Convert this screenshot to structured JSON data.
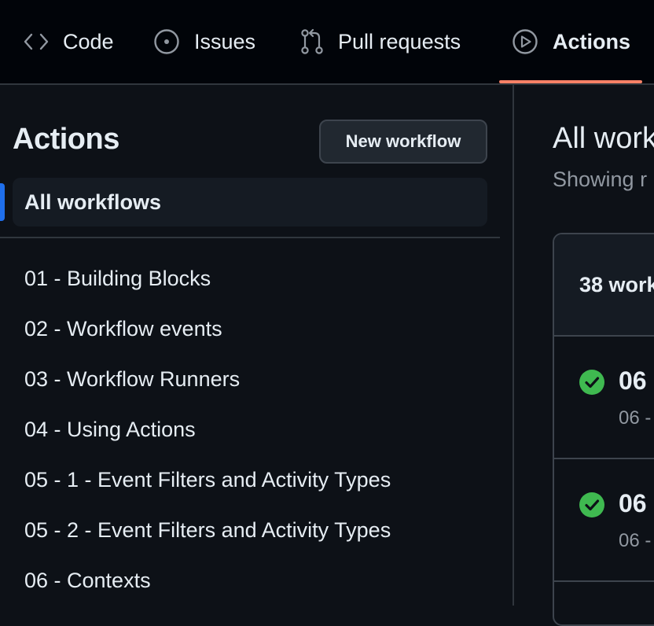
{
  "nav": {
    "tabs": [
      {
        "label": "Code",
        "icon": "code-icon"
      },
      {
        "label": "Issues",
        "icon": "issue-opened-icon"
      },
      {
        "label": "Pull requests",
        "icon": "git-pull-request-icon"
      },
      {
        "label": "Actions",
        "icon": "play-icon",
        "active": true
      }
    ]
  },
  "sidebar": {
    "title": "Actions",
    "new_workflow_label": "New workflow",
    "all_workflows_label": "All workflows",
    "workflows": [
      "01 - Building Blocks",
      "02 - Workflow events",
      "03 - Workflow Runners",
      "04 - Using Actions",
      "05 - 1 - Event Filters and Activity Types",
      "05 - 2 - Event Filters and Activity Types",
      "06 - Contexts"
    ]
  },
  "main": {
    "title": "All work",
    "subtitle": "Showing r",
    "runs_header": "38 work",
    "runs": [
      {
        "title": "06",
        "subtitle": "06 -",
        "status": "success"
      },
      {
        "title": "06",
        "subtitle": "06 -",
        "status": "success"
      }
    ]
  },
  "colors": {
    "accent_underline": "#f78166",
    "selection": "#1f6feb",
    "success": "#3fb950"
  }
}
